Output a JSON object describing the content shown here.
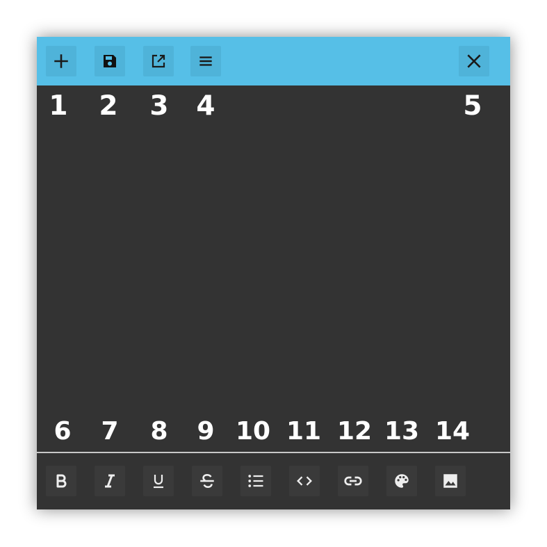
{
  "titlebar": {
    "buttons": [
      {
        "name": "add-icon"
      },
      {
        "name": "save-icon"
      },
      {
        "name": "open-external-icon"
      },
      {
        "name": "menu-icon"
      },
      {
        "name": "close-icon"
      }
    ],
    "numbers": [
      "1",
      "2",
      "3",
      "4",
      "5"
    ],
    "color": "#56bfe7"
  },
  "toolbar": {
    "buttons": [
      {
        "name": "bold-icon"
      },
      {
        "name": "italic-icon"
      },
      {
        "name": "underline-icon"
      },
      {
        "name": "strikethrough-icon"
      },
      {
        "name": "bullet-list-icon"
      },
      {
        "name": "code-icon"
      },
      {
        "name": "link-icon"
      },
      {
        "name": "palette-icon"
      },
      {
        "name": "image-icon"
      }
    ],
    "numbers": [
      "6",
      "7",
      "8",
      "9",
      "10",
      "11",
      "12",
      "13",
      "14"
    ]
  },
  "colors": {
    "background": "#333333",
    "foreground": "#ffffff"
  }
}
